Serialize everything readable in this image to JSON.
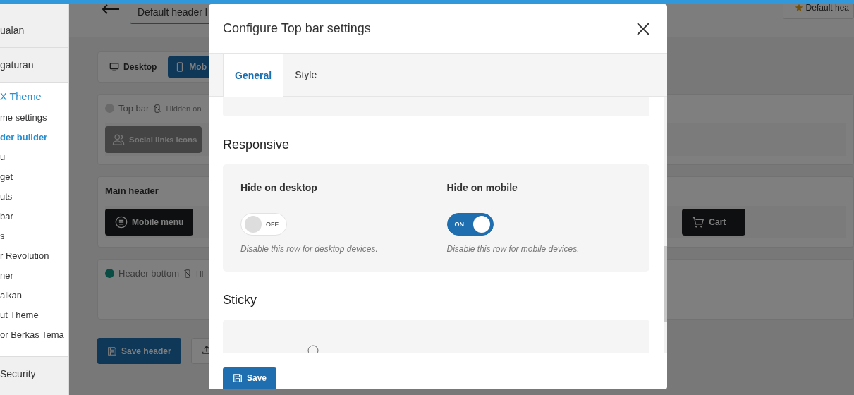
{
  "sidebar": {
    "items_above": [
      {
        "label": "ualan"
      },
      {
        "label": "gaturan"
      }
    ],
    "current_menu": {
      "label": "X Theme",
      "submenu": [
        {
          "label": "me settings",
          "selected": false
        },
        {
          "label": "der builder",
          "selected": true
        },
        {
          "label": "u",
          "selected": false
        },
        {
          "label": "get",
          "selected": false
        },
        {
          "label": "uts",
          "selected": false
        },
        {
          "label": "bar",
          "selected": false
        },
        {
          "label": "s",
          "selected": false
        },
        {
          "label": "r Revolution",
          "selected": false
        },
        {
          "label": "ner",
          "selected": false
        },
        {
          "label": "aikan",
          "selected": false
        },
        {
          "label": "ut Theme",
          "selected": false
        },
        {
          "label": "or Berkas Tema",
          "selected": false
        }
      ]
    },
    "items_below": [
      {
        "label": "Security"
      }
    ]
  },
  "builder": {
    "header_name_input": {
      "value": "Default header l"
    },
    "default_badge": "Default hea",
    "device_tabs": [
      {
        "label": "Desktop",
        "kind": "desktop",
        "selected": false
      },
      {
        "label": "Mob",
        "kind": "mobile",
        "selected": true
      }
    ],
    "rows": [
      {
        "title": "Top bar",
        "color": "#696969",
        "note": "Hidden on",
        "elements": [
          {
            "label": "Social links icons",
            "kind": "social"
          }
        ]
      },
      {
        "title": "Main header",
        "elements": [
          {
            "label": "Mobile menu",
            "kind": "menu"
          },
          {
            "label": "Cart",
            "kind": "cart"
          }
        ]
      },
      {
        "title": "Header bottom",
        "color": "#0a4d45",
        "note": "Hi",
        "elements": []
      }
    ],
    "save_button": "Save header"
  },
  "modal": {
    "title": "Configure Top bar settings",
    "tabs": [
      {
        "label": "General",
        "selected": true
      },
      {
        "label": "Style",
        "selected": false
      }
    ],
    "sections": [
      {
        "heading": "Responsive",
        "options": [
          {
            "label": "Hide on desktop",
            "on": false,
            "state_text": "OFF",
            "description": "Disable this row for desktop devices."
          },
          {
            "label": "Hide on mobile",
            "on": true,
            "state_text": "ON",
            "description": "Disable this row for mobile devices."
          }
        ]
      },
      {
        "heading": "Sticky"
      }
    ],
    "save_button": "Save"
  }
}
